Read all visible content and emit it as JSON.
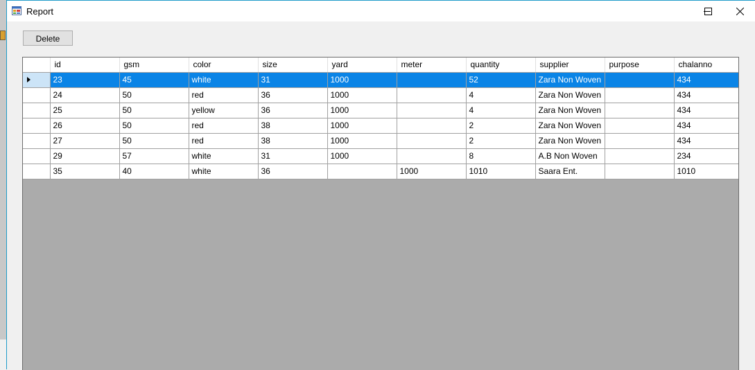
{
  "window": {
    "title": "Report",
    "border_color": "#1d9bc9",
    "controls": [
      "minimize-icon",
      "maximize-icon",
      "close-icon"
    ]
  },
  "toolbar": {
    "delete_label": "Delete"
  },
  "grid": {
    "selection_color": "#0a84e6",
    "columns": [
      "id",
      "gsm",
      "color",
      "size",
      "yard",
      "meter",
      "quantity",
      "supplier",
      "purpose",
      "chalanno"
    ],
    "selected_row": 0,
    "rows": [
      [
        "23",
        "45",
        "white",
        "31",
        "1000",
        "",
        "52",
        "Zara Non Woven",
        "",
        "434"
      ],
      [
        "24",
        "50",
        "red",
        "36",
        "1000",
        "",
        "4",
        "Zara Non Woven",
        "",
        "434"
      ],
      [
        "25",
        "50",
        "yellow",
        "36",
        "1000",
        "",
        "4",
        "Zara Non Woven",
        "",
        "434"
      ],
      [
        "26",
        "50",
        "red",
        "38",
        "1000",
        "",
        "2",
        "Zara Non Woven",
        "",
        "434"
      ],
      [
        "27",
        "50",
        "red",
        "38",
        "1000",
        "",
        "2",
        "Zara Non Woven",
        "",
        "434"
      ],
      [
        "29",
        "57",
        "white",
        "31",
        "1000",
        "",
        "8",
        "A.B Non Woven",
        "",
        "234"
      ],
      [
        "35",
        "40",
        "white",
        "36",
        "",
        "1000",
        "1010",
        "Saara Ent.",
        "",
        "1010"
      ]
    ]
  }
}
